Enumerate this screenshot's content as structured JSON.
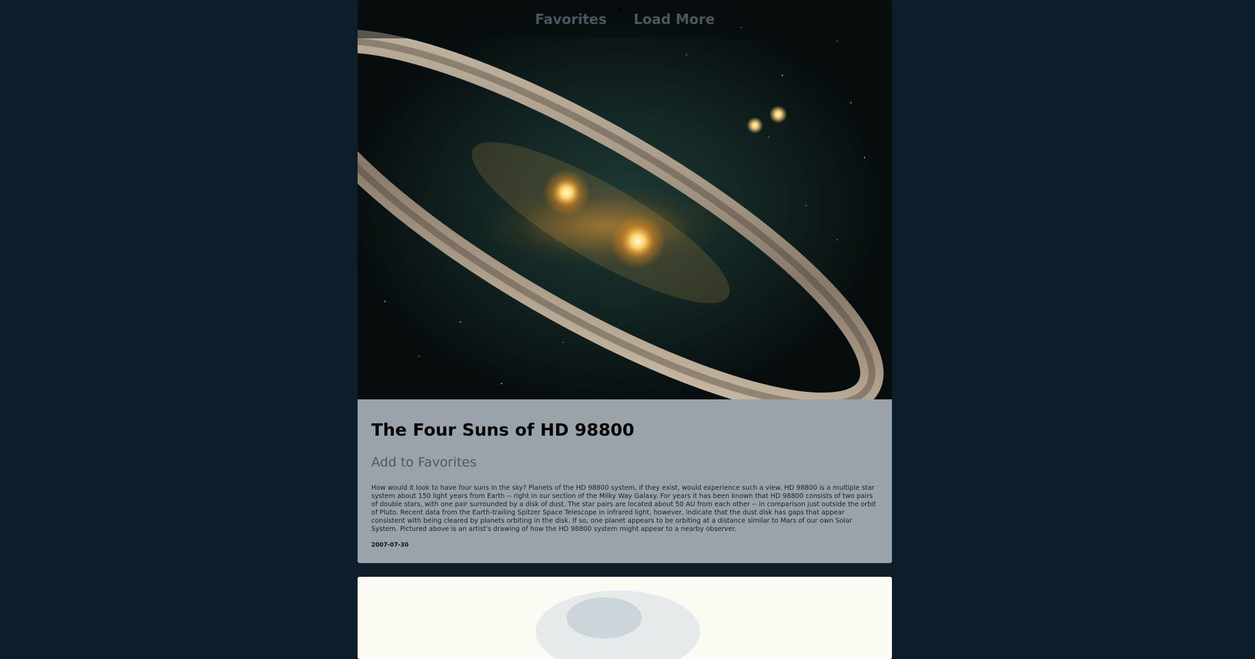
{
  "nav": {
    "favorites_label": "Favorites",
    "load_more_label": "Load More"
  },
  "posts": [
    {
      "title": "The Four Suns of HD 98800",
      "favorite_label": "Add to Favorites",
      "explanation": "How would it look to have four suns in the sky? Planets of the HD 98800 system, if they exist, would experience such a view. HD 98800 is a multiple star system about 150 light years from Earth -- right in our section of the Milky Way Galaxy. For years it has been known that HD 98800 consists of two pairs of double stars, with one pair surrounded by a disk of dust. The star pairs are located about 50 AU from each other -- in comparison just outside the orbit of Pluto. Recent data from the Earth-trailing Spitzer Space Telescope in infrared light, however, indicate that the dust disk has gaps that appear consistent with being cleared by planets orbiting in the disk. If so, one planet appears to be orbiting at a distance similar to Mars of our own Solar System. Pictured above is an artist's drawing of how the HD 98800 system might appear to a nearby observer.",
      "date": "2007-07-30"
    }
  ],
  "colors": {
    "page_background": "#0d1d2a",
    "card_background": "#9ba3aa",
    "nav_link": "#4a5660"
  }
}
